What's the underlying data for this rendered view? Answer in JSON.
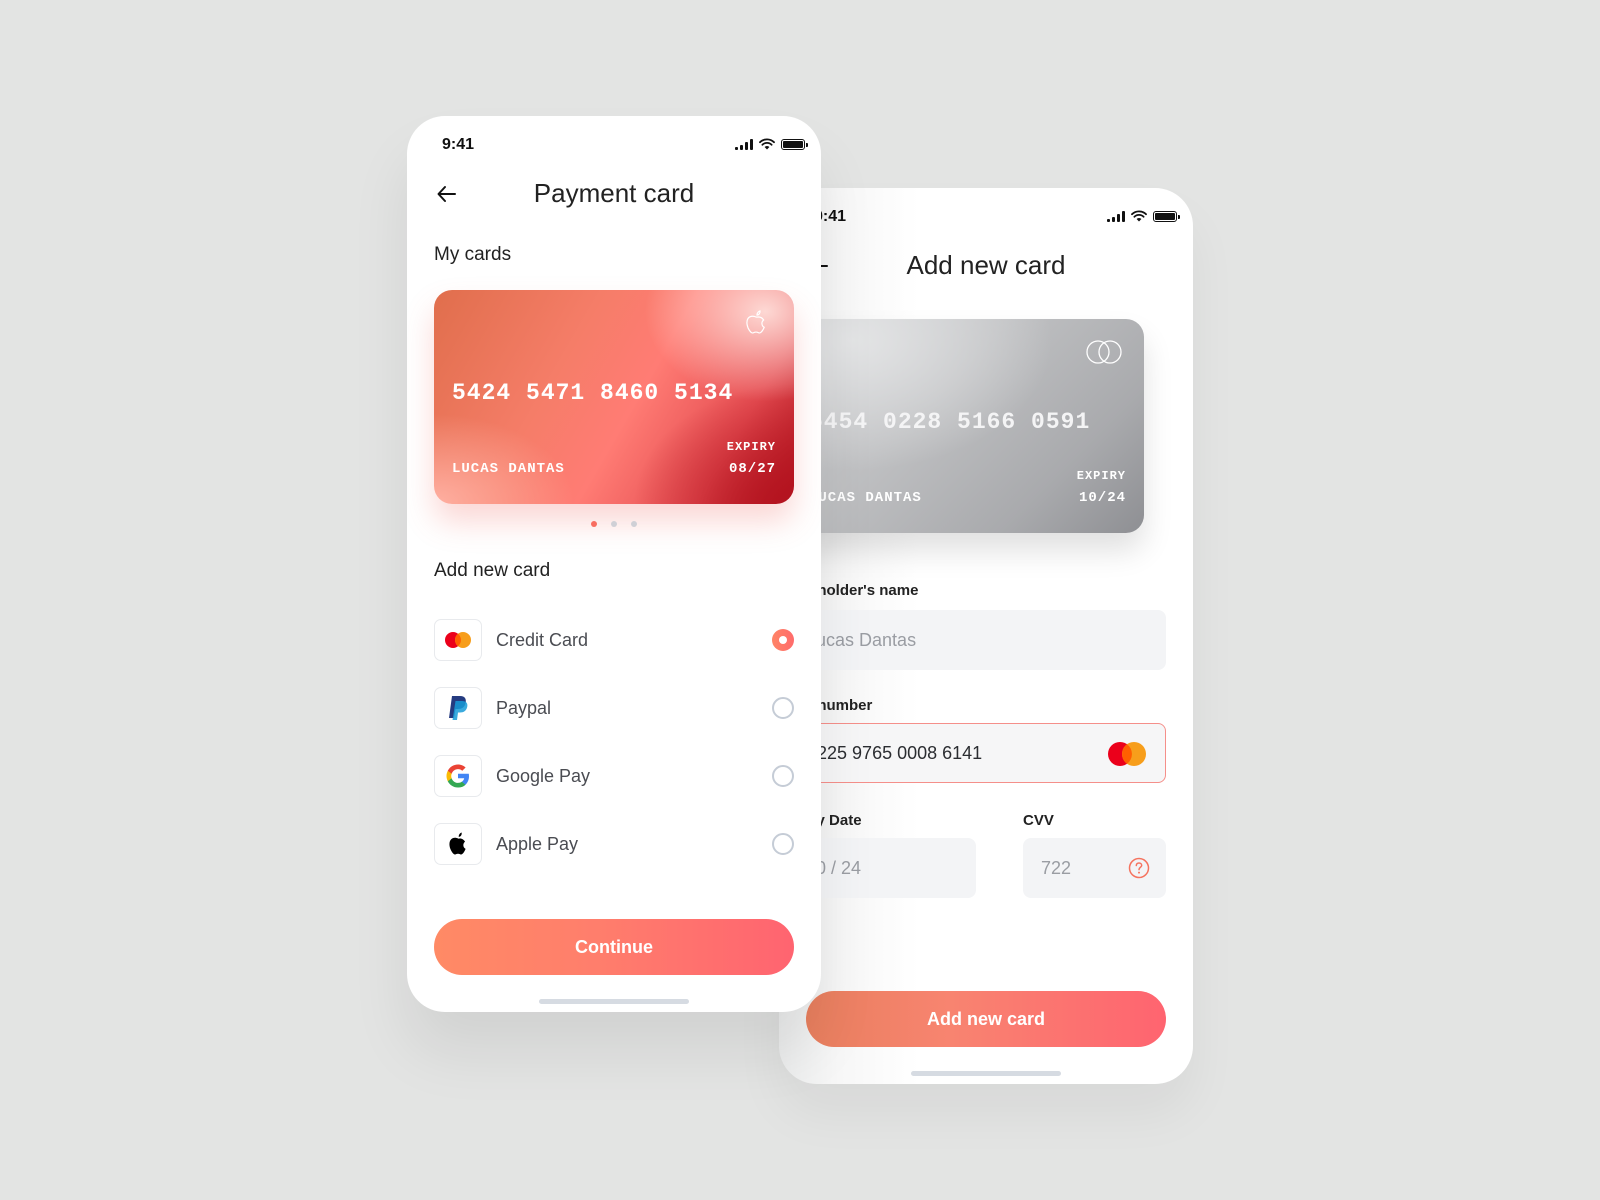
{
  "left_screen": {
    "status": {
      "time": "9:41"
    },
    "header": {
      "title": "Payment card",
      "back_icon": "arrow-left-icon"
    },
    "my_cards": {
      "title": "My cards",
      "card": {
        "number": "5424 5471 8460 5134",
        "holder": "LUCAS DANTAS",
        "expiry_label": "EXPIRY",
        "expiry": "08/27",
        "logo": "apple-icon"
      },
      "pagination": {
        "count": 3,
        "active_index": 0
      }
    },
    "add_new_card": {
      "title": "Add new card",
      "methods": [
        {
          "label": "Credit Card",
          "icon": "mastercard-icon",
          "selected": true
        },
        {
          "label": "Paypal",
          "icon": "paypal-icon",
          "selected": false
        },
        {
          "label": "Google Pay",
          "icon": "google-icon",
          "selected": false
        },
        {
          "label": "Apple Pay",
          "icon": "apple-icon",
          "selected": false
        }
      ]
    },
    "continue_label": "Continue"
  },
  "right_screen": {
    "status": {
      "time": "9:41"
    },
    "header": {
      "title": "Add new card"
    },
    "card": {
      "number": "5454 0228 5166 0591",
      "holder": "LUCAS DANTAS",
      "expiry_label": "EXPIRY",
      "expiry": "10/24",
      "logo": "mastercard-outline-icon"
    },
    "form": {
      "holder_name": {
        "label": "Card holder's name",
        "value": "Lucas Dantas"
      },
      "card_number": {
        "label": "Card number",
        "value": "4225 9765 0008 6141"
      },
      "expiry_date": {
        "label": "Expiry Date",
        "value": "10 / 24"
      },
      "cvv": {
        "label": "CVV",
        "value": "722"
      }
    },
    "submit_label": "Add new card"
  },
  "colors": {
    "accent": "#ff6b6b",
    "accent_start": "#ff8a65",
    "background": "#e3e4e3",
    "radio_inactive": "#c5ccd6"
  }
}
